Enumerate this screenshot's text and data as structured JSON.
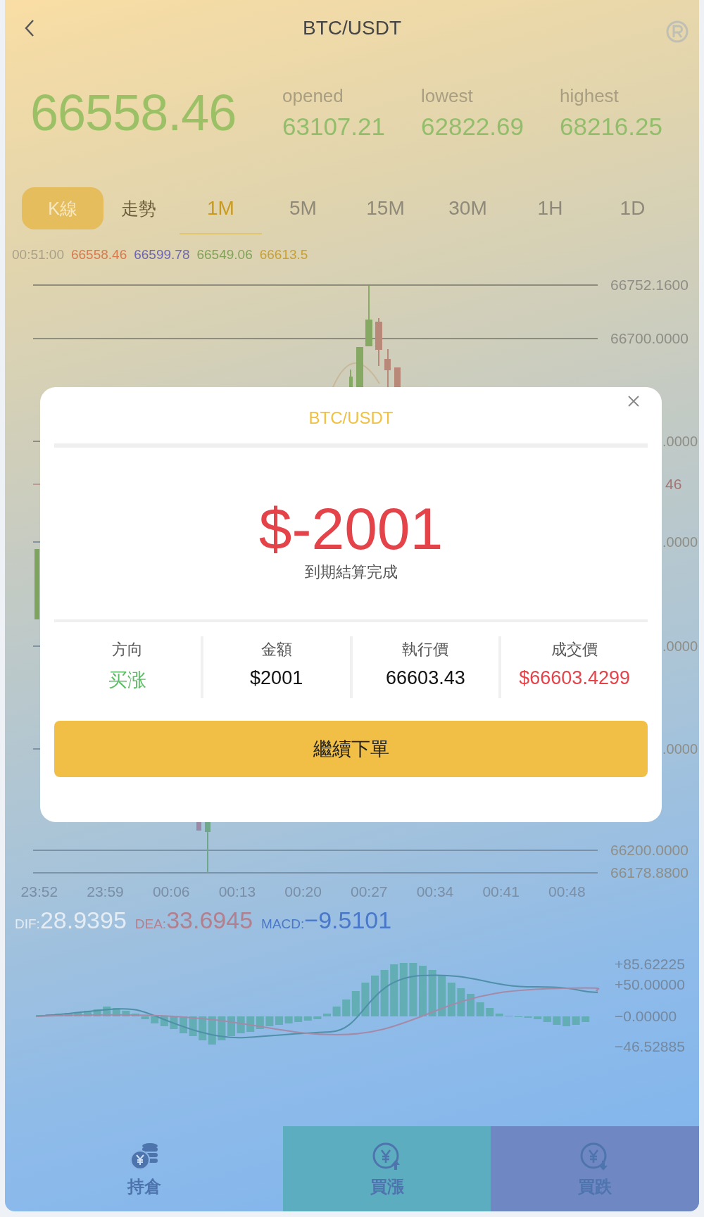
{
  "header": {
    "title": "BTC/USDT"
  },
  "ticker": {
    "price": "66558.46",
    "stats": [
      {
        "label": "opened",
        "value": "63107.21"
      },
      {
        "label": "lowest",
        "value": "62822.69"
      },
      {
        "label": "highest",
        "value": "68216.25"
      }
    ]
  },
  "chart_modes": [
    {
      "label": "K線",
      "selected": true
    },
    {
      "label": "走勢",
      "selected": false
    }
  ],
  "intervals": [
    {
      "label": "1M",
      "selected": true
    },
    {
      "label": "5M",
      "selected": false
    },
    {
      "label": "15M",
      "selected": false
    },
    {
      "label": "30M",
      "selected": false
    },
    {
      "label": "1H",
      "selected": false
    },
    {
      "label": "1D",
      "selected": false
    }
  ],
  "ohlc_legend": [
    {
      "text": "00:51:00",
      "color": "#a8a088"
    },
    {
      "text": "66558.46",
      "color": "#d97a4e"
    },
    {
      "text": "66599.78",
      "color": "#6d66b3"
    },
    {
      "text": "66549.06",
      "color": "#80a259"
    },
    {
      "text": "66613.5",
      "color": "#c9a034"
    }
  ],
  "price_axis": [
    {
      "label": "66752.1600",
      "kind": "grid"
    },
    {
      "label": "66700.0000",
      "kind": "grid"
    },
    {
      "label": ".0000",
      "kind": "grid"
    },
    {
      "label": "46",
      "kind": "current"
    },
    {
      "label": ".0000",
      "kind": "grid"
    },
    {
      "label": ".0000",
      "kind": "grid"
    },
    {
      "label": ".0000",
      "kind": "grid"
    },
    {
      "label": "66200.0000",
      "kind": "grid"
    },
    {
      "label": "66178.8800",
      "kind": "grid"
    }
  ],
  "time_axis": [
    "23:52",
    "23:59",
    "00:06",
    "00:13",
    "00:20",
    "00:27",
    "00:34",
    "00:41",
    "00:48"
  ],
  "macd_legend": [
    {
      "label": "DIF:",
      "value": "28.9395",
      "color": "#e4ecf4"
    },
    {
      "label": "DEA:",
      "value": "33.6945",
      "color": "#b27f8f"
    },
    {
      "label": "MACD:",
      "value": "−9.5101",
      "color": "#4a78c8"
    }
  ],
  "macd_axis": [
    "+85.62225",
    "+50.00000",
    "−0.00000",
    "−46.52885"
  ],
  "dialog": {
    "title": "BTC/USDT",
    "amount": "$-2001",
    "status": "到期結算完成",
    "details": [
      {
        "label": "方向",
        "value": "买涨",
        "kind": "up"
      },
      {
        "label": "金額",
        "value": "$2001",
        "kind": "plain"
      },
      {
        "label": "執行價",
        "value": "66603.43",
        "kind": "plain"
      },
      {
        "label": "成交價",
        "value": "$66603.4299",
        "kind": "loss"
      }
    ],
    "button": "繼續下單"
  },
  "bottom_nav": [
    {
      "label": "持倉",
      "kind": "positions"
    },
    {
      "label": "買漲",
      "kind": "buy_up"
    },
    {
      "label": "買跌",
      "kind": "buy_down"
    }
  ]
}
